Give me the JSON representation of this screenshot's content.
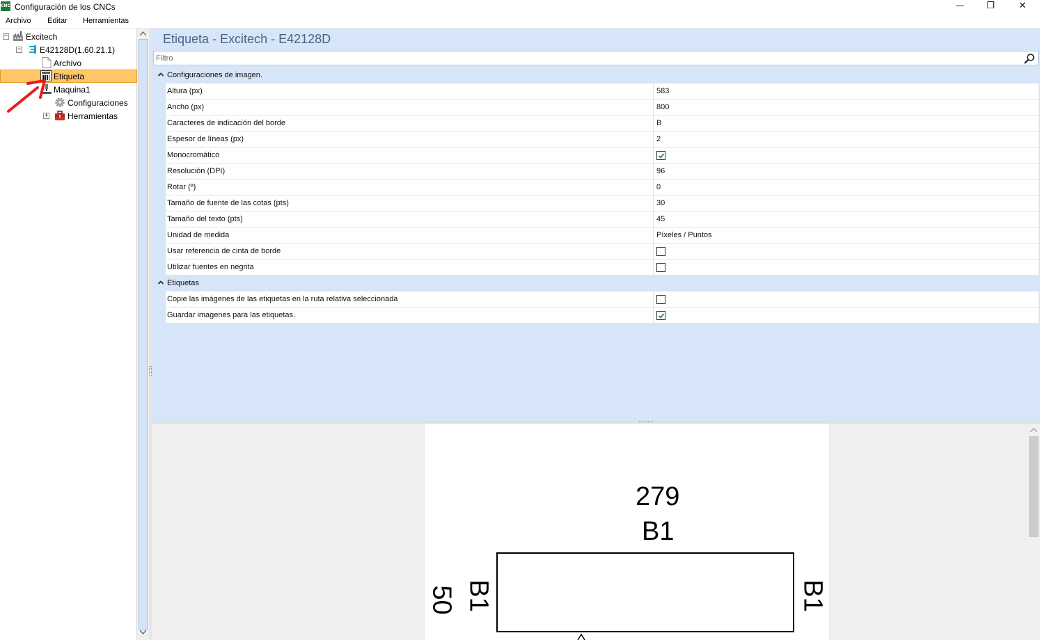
{
  "window": {
    "title": "Configuración de los CNCs",
    "app_icon_text": "CNC",
    "minimize": "—",
    "restore": "❐",
    "close": "✕"
  },
  "menu": [
    "Archivo",
    "Editar",
    "Herramientas"
  ],
  "tree": {
    "root": "Excitech",
    "device": "E42128D(1.60.21.1)",
    "archivo": "Archivo",
    "etiqueta": "Etiqueta",
    "maquina": "Maquina1",
    "configuraciones": "Configuraciones",
    "herramientas": "Herramientas"
  },
  "panel": {
    "title": "Etiqueta - Excitech - E42128D",
    "filter_placeholder": "Filtro"
  },
  "sections": [
    {
      "label": "Configuraciones de imagen.",
      "rows": [
        {
          "name": "Altura (px)",
          "value": "583"
        },
        {
          "name": "Ancho (px)",
          "value": "800"
        },
        {
          "name": "Caracteres de indicación del borde",
          "value": "B"
        },
        {
          "name": "Espesor de líneas (px)",
          "value": "2"
        },
        {
          "name": "Monocromático",
          "checked": true
        },
        {
          "name": "Resolución (DPI)",
          "value": "96"
        },
        {
          "name": "Rotar (º)",
          "value": "0"
        },
        {
          "name": "Tamaño de fuente de las cotas (pts)",
          "value": "30"
        },
        {
          "name": "Tamaño del texto (pts)",
          "value": "45"
        },
        {
          "name": "Unidad de medida",
          "value": "Píxeles / Puntos"
        },
        {
          "name": "Usar referencia de cinta de borde",
          "checked": false
        },
        {
          "name": "Utilizar fuentes en negrita",
          "checked": false
        }
      ]
    },
    {
      "label": "Etiquetas",
      "rows": [
        {
          "name": "Copie las imágenes de las etiquetas en la ruta relativa seleccionada",
          "checked": false
        },
        {
          "name": "Guardar imagenes para las etiquetas.",
          "checked": true
        }
      ]
    }
  ],
  "preview": {
    "width_dim": "279",
    "top_edge": "B1",
    "height_dim": "50",
    "left_edge": "B1",
    "right_edge": "B1"
  },
  "colors": {
    "selected_bg": "#ffc76a",
    "panel_bg": "#d7e5f8",
    "annotation_arrow": "#e0201c"
  }
}
